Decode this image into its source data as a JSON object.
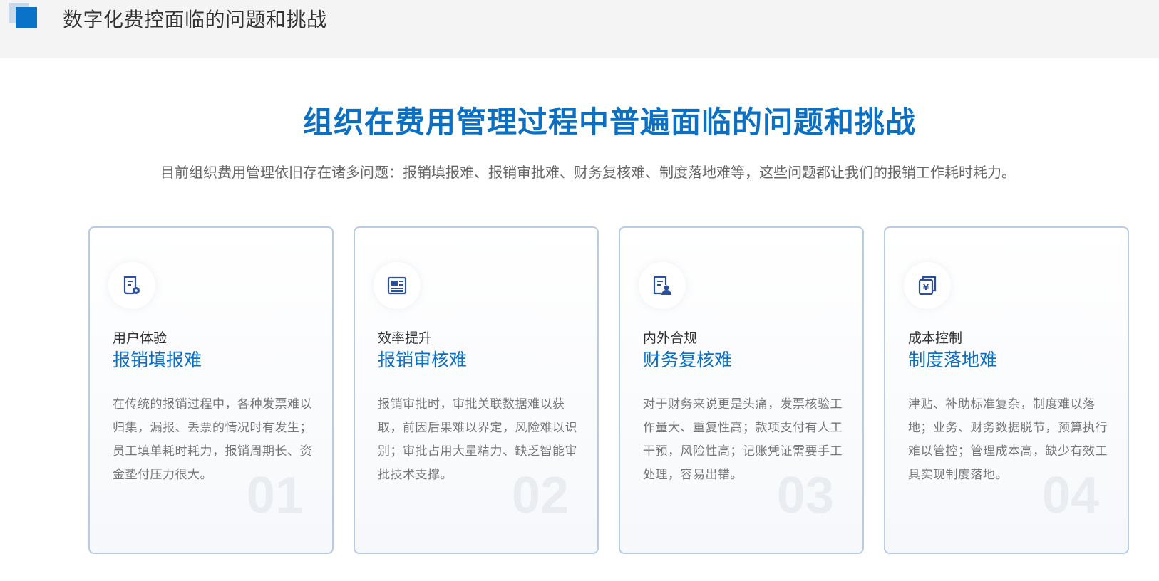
{
  "header": {
    "title": "数字化费控面临的问题和挑战"
  },
  "main": {
    "title": "组织在费用管理过程中普遍面临的问题和挑战",
    "subtitle": "目前组织费用管理依旧存在诸多问题：报销填报难、报销审批难、财务复核难、制度落地难等，这些问题都让我们的报销工作耗时耗力。"
  },
  "colors": {
    "accent": "#0b6fc4",
    "card_border": "#b8cce6",
    "icon": "#2c4f9e"
  },
  "cards": [
    {
      "icon": "receipt-icon",
      "category": "用户体验",
      "title": "报销填报难",
      "description": "在传统的报销过程中，各种发票难以归集，漏报、丢票的情况时有发生；员工填单耗时耗力，报销周期长、资金垫付压力很大。",
      "number": "01"
    },
    {
      "icon": "document-list-icon",
      "category": "效率提升",
      "title": "报销审核难",
      "description": "报销审批时，审批关联数据难以获取，前因后果难以界定，风险难以识别；审批占用大量精力、缺乏智能审批技术支撑。",
      "number": "02"
    },
    {
      "icon": "document-user-icon",
      "category": "内外合规",
      "title": "财务复核难",
      "description": "对于财务来说更是头痛，发票核验工作量大、重复性高；款项支付有人工干预，风险性高；记账凭证需要手工处理，容易出错。",
      "number": "03"
    },
    {
      "icon": "yuan-document-icon",
      "category": "成本控制",
      "title": "制度落地难",
      "description": "津贴、补助标准复杂，制度难以落地；业务、财务数据脱节，预算执行难以管控；管理成本高，缺少有效工具实现制度落地。",
      "number": "04"
    }
  ]
}
